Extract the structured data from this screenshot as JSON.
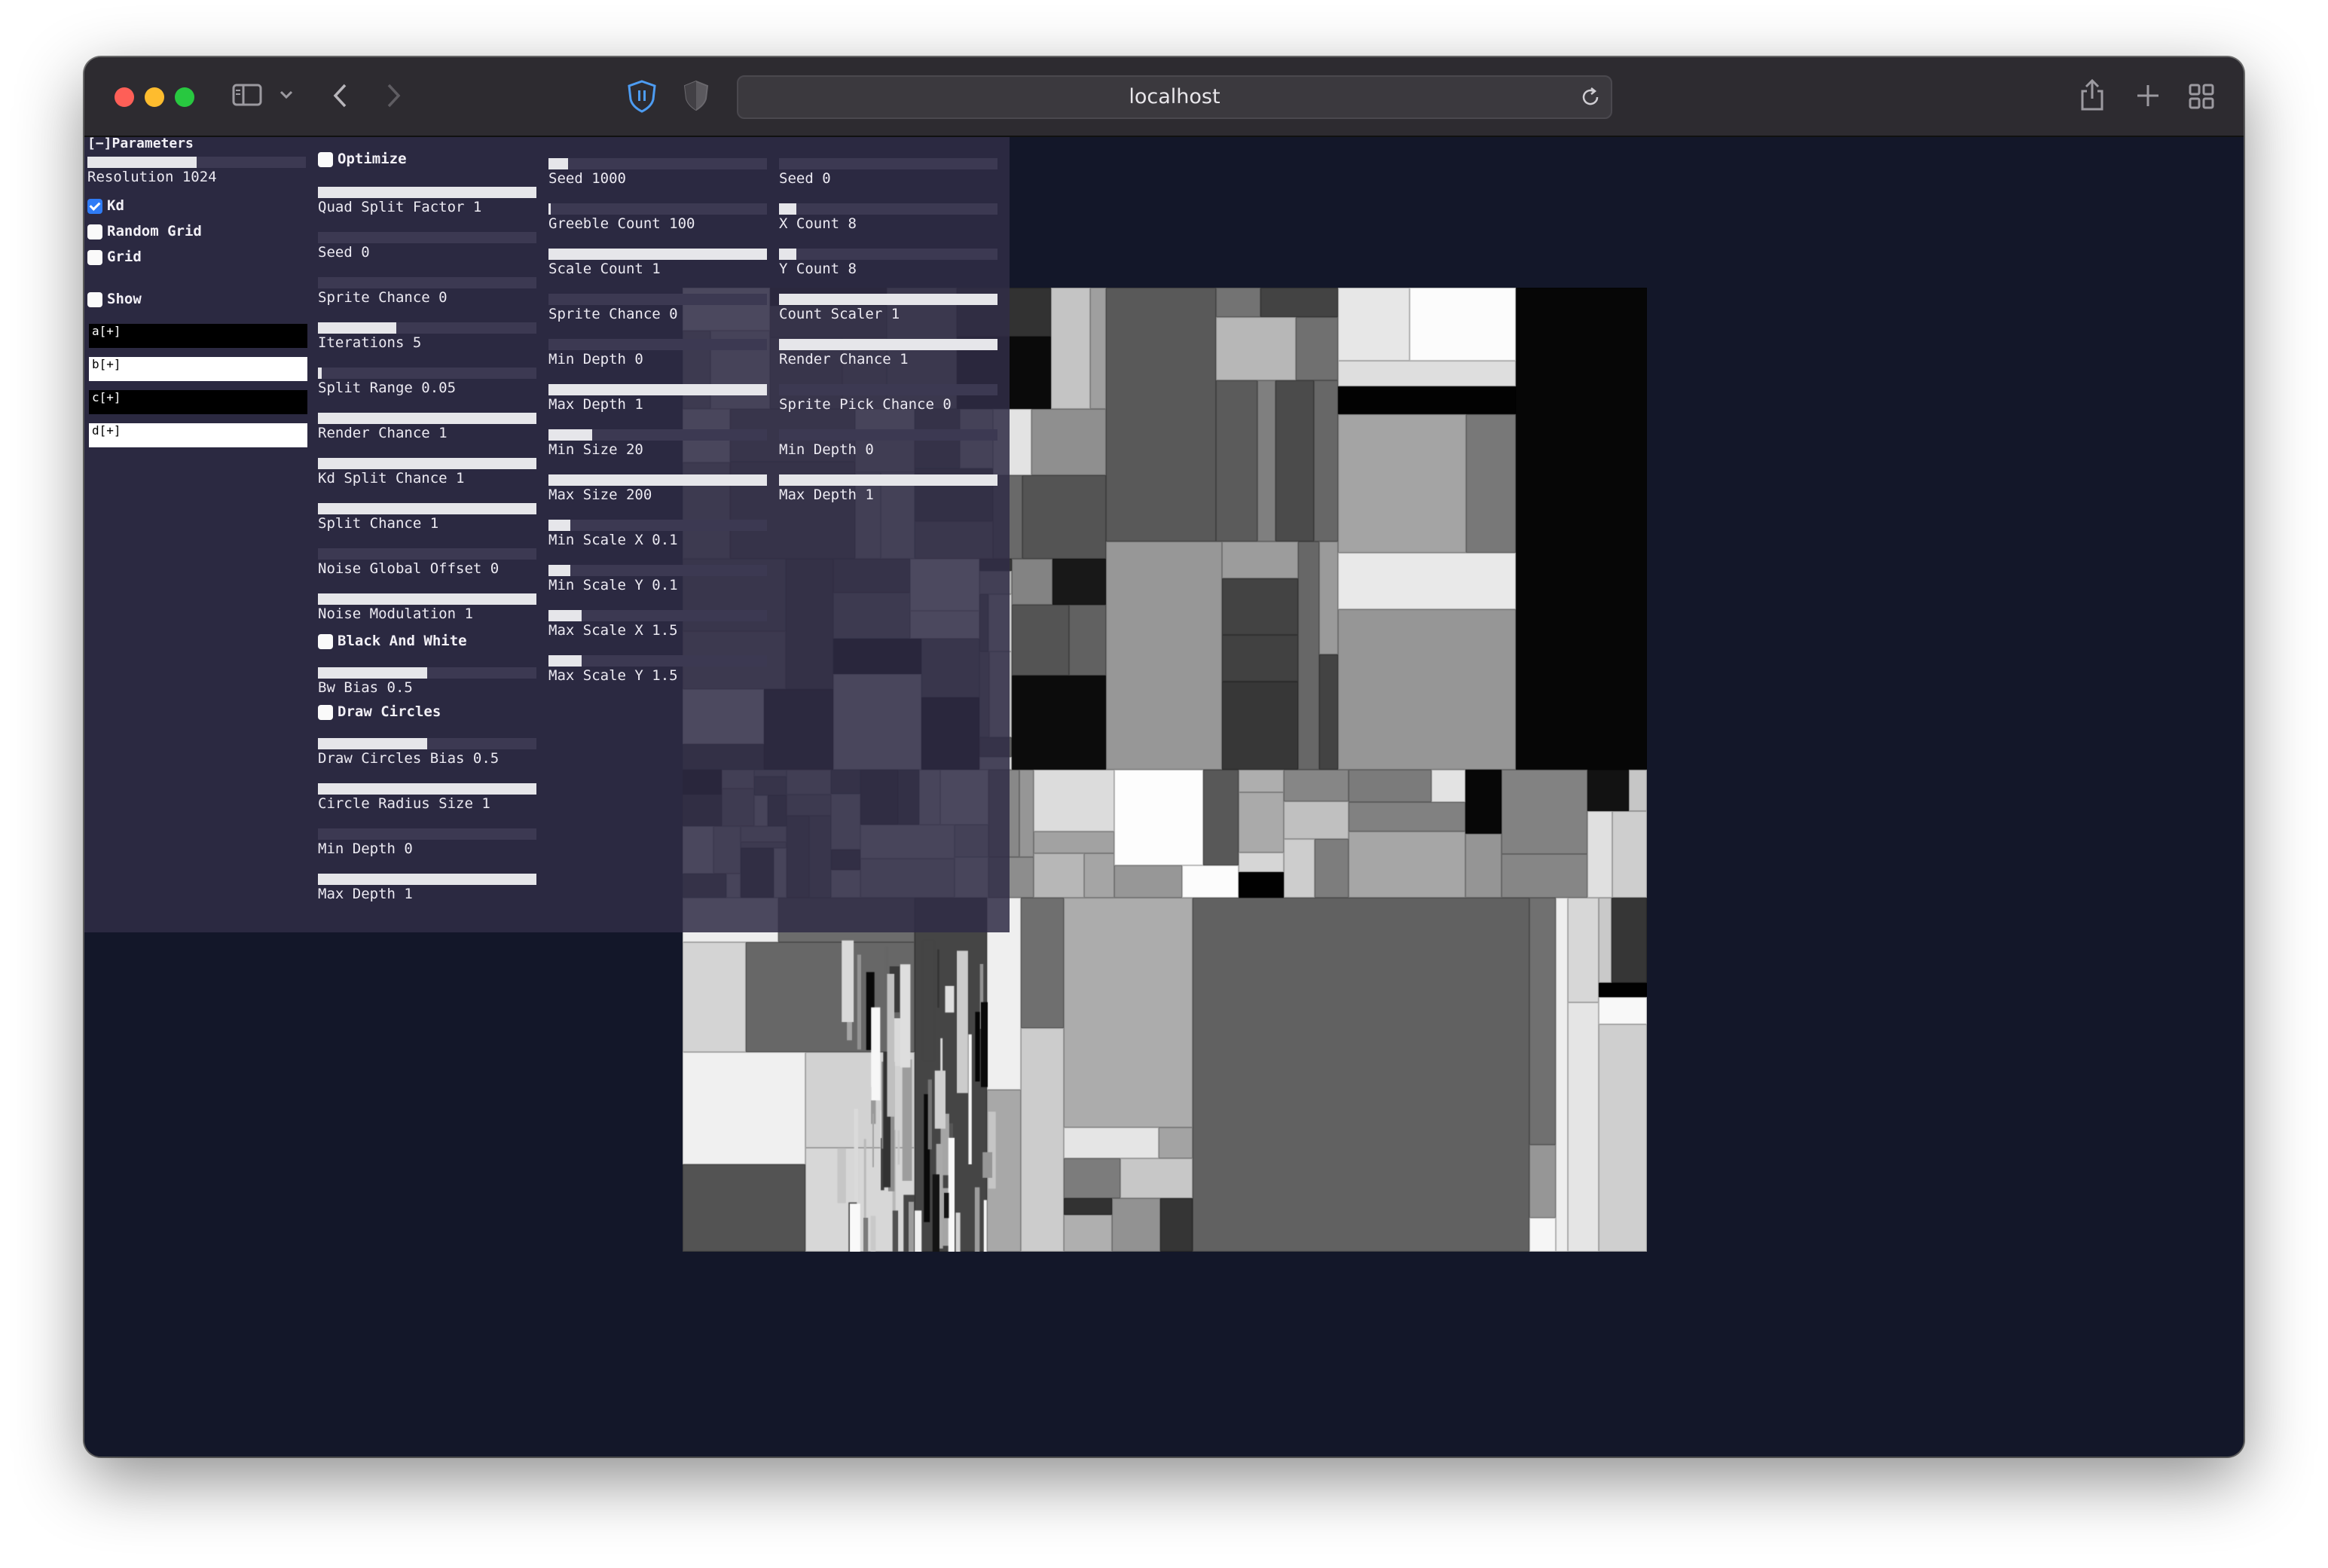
{
  "browser": {
    "url": "localhost",
    "traffic_lights": [
      "#fe5f57",
      "#febc2e",
      "#28c840"
    ],
    "icons": {
      "sidebar": "sidebar-icon",
      "chevron": "chevron-down-icon",
      "back": "back-arrow-icon",
      "forward": "forward-arrow-icon",
      "shield": "shield-icon",
      "privacy": "privacy-shield-icon",
      "reload": "reload-icon",
      "share": "share-icon",
      "newtab": "plus-icon",
      "tabs": "tab-overview-icon"
    }
  },
  "panel": {
    "title": "[−]Parameters",
    "col1": {
      "resolution": {
        "label": "Resolution 1024",
        "fraction": 0.5
      },
      "checks": [
        {
          "label": "Kd",
          "checked": true
        },
        {
          "label": "Random Grid",
          "checked": false
        },
        {
          "label": "Grid",
          "checked": false
        },
        {
          "label": "Show",
          "checked": false
        }
      ],
      "colors": [
        {
          "label": "a[+]",
          "value": "#000000"
        },
        {
          "label": "b[+]",
          "value": "#ffffff"
        },
        {
          "label": "c[+]",
          "value": "#000000"
        },
        {
          "label": "d[+]",
          "value": "#ffffff"
        }
      ]
    },
    "col2": {
      "optimize": {
        "label": "Optimize",
        "checked": false
      },
      "sliders": [
        {
          "label": "Quad Split Factor 1",
          "fraction": 1.0
        },
        {
          "label": "Seed 0",
          "fraction": 0.0
        },
        {
          "label": "Sprite Chance 0",
          "fraction": 0.0
        },
        {
          "label": "Iterations 5",
          "fraction": 0.36
        },
        {
          "label": "Split Range 0.05",
          "fraction": 0.02
        },
        {
          "label": "Render Chance 1",
          "fraction": 1.0
        },
        {
          "label": "Kd Split Chance 1",
          "fraction": 1.0
        },
        {
          "label": "Split Chance 1",
          "fraction": 1.0
        },
        {
          "label": "Noise Global Offset 0",
          "fraction": 0.0
        },
        {
          "label": "Noise Modulation 1",
          "fraction": 1.0
        }
      ],
      "bw": {
        "label": "Black And White",
        "checked": false
      },
      "bw_bias": {
        "label": "Bw Bias 0.5",
        "fraction": 0.5
      },
      "circles": {
        "label": "Draw Circles",
        "checked": false
      },
      "sliders2": [
        {
          "label": "Draw Circles Bias 0.5",
          "fraction": 0.5
        },
        {
          "label": "Circle Radius Size 1",
          "fraction": 1.0
        },
        {
          "label": "Min Depth 0",
          "fraction": 0.0
        },
        {
          "label": "Max Depth 1",
          "fraction": 1.0
        }
      ]
    },
    "col3": {
      "sliders": [
        {
          "label": "Seed 1000",
          "fraction": 0.09
        },
        {
          "label": "Greeble Count 100",
          "fraction": 0.01
        },
        {
          "label": "Scale Count 1",
          "fraction": 1.0
        },
        {
          "label": "Sprite Chance 0",
          "fraction": 0.0
        },
        {
          "label": "Min Depth 0",
          "fraction": 0.0
        },
        {
          "label": "Max Depth 1",
          "fraction": 1.0
        },
        {
          "label": "Min Size 20",
          "fraction": 0.2
        },
        {
          "label": "Max Size 200",
          "fraction": 1.0
        },
        {
          "label": "Min Scale X 0.1",
          "fraction": 0.1
        },
        {
          "label": "Min Scale Y 0.1",
          "fraction": 0.1
        },
        {
          "label": "Max Scale X 1.5",
          "fraction": 0.15
        },
        {
          "label": "Max Scale Y 1.5",
          "fraction": 0.15
        }
      ]
    },
    "col4": {
      "sliders": [
        {
          "label": "Seed 0",
          "fraction": 0.0
        },
        {
          "label": "X Count 8",
          "fraction": 0.08
        },
        {
          "label": "Y Count 8",
          "fraction": 0.08
        },
        {
          "label": "Count Scaler 1",
          "fraction": 1.0
        },
        {
          "label": "Render Chance 1",
          "fraction": 1.0
        },
        {
          "label": "Sprite Pick Chance 0",
          "fraction": 0.0
        },
        {
          "label": "Min Depth 0",
          "fraction": 0.0
        },
        {
          "label": "Max Depth 1",
          "fraction": 1.0
        }
      ]
    }
  }
}
